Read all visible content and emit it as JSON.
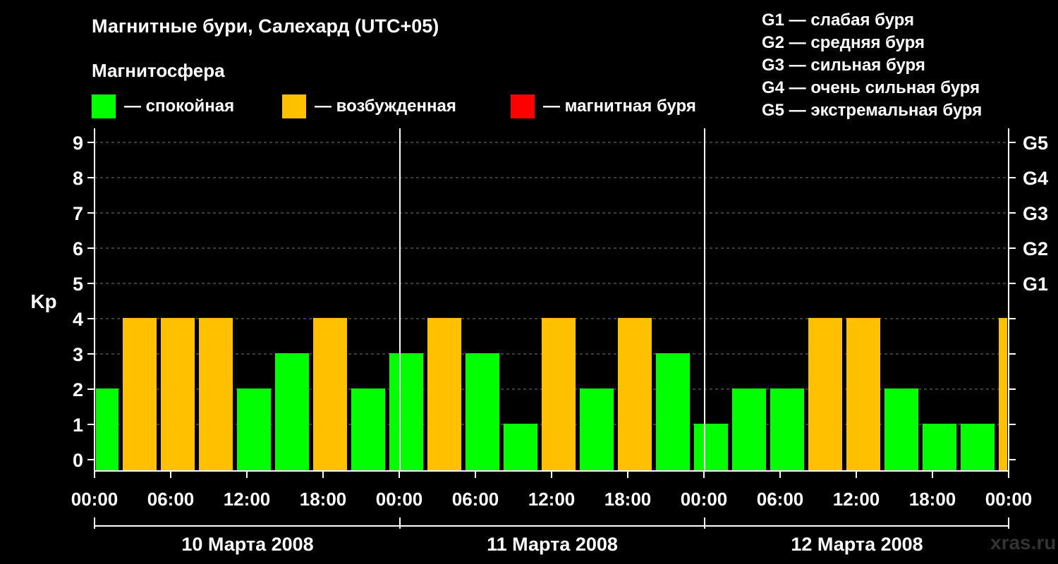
{
  "title": "Магнитные бури, Салехард (UTC+05)",
  "subtitle": "Магнитосфера",
  "legend": [
    {
      "label": "— спокойная",
      "color": "#00ff00"
    },
    {
      "label": "— возбужденная",
      "color": "#ffc000"
    },
    {
      "label": "— магнитная буря",
      "color": "#ff0000"
    }
  ],
  "g_legend": [
    "G1 — слабая буря",
    "G2 — средняя буря",
    "G3 — сильная буря",
    "G4 — очень сильная буря",
    "G5 — экстремальная буря"
  ],
  "watermark": "xras.ru",
  "colors": {
    "quiet": "#00ff00",
    "unsettled": "#ffc000",
    "storm": "#ff0000"
  },
  "chart_data": {
    "type": "bar",
    "ylabel": "Kp",
    "ylim": [
      0,
      9
    ],
    "yticks": [
      0,
      1,
      2,
      3,
      4,
      5,
      6,
      7,
      8,
      9
    ],
    "right_axis_labels": [
      {
        "kp": 5,
        "label": "G1"
      },
      {
        "kp": 6,
        "label": "G2"
      },
      {
        "kp": 7,
        "label": "G3"
      },
      {
        "kp": 8,
        "label": "G4"
      },
      {
        "kp": 9,
        "label": "G5"
      }
    ],
    "x_tick_labels": [
      "00:00",
      "06:00",
      "12:00",
      "18:00",
      "00:00",
      "06:00",
      "12:00",
      "18:00",
      "00:00",
      "06:00",
      "12:00",
      "18:00",
      "00:00"
    ],
    "days": [
      "10 Марта 2008",
      "11 Марта 2008",
      "12 Марта 2008"
    ],
    "grid": true,
    "series": [
      {
        "values": [
          2,
          4,
          4,
          4,
          2,
          3,
          4,
          2,
          3,
          4,
          3,
          1,
          4,
          2,
          4,
          3,
          1,
          2,
          2,
          4,
          4,
          2,
          1,
          1,
          4
        ],
        "levels": [
          "quiet",
          "unsettled",
          "unsettled",
          "unsettled",
          "quiet",
          "quiet",
          "unsettled",
          "quiet",
          "quiet",
          "unsettled",
          "quiet",
          "quiet",
          "unsettled",
          "quiet",
          "unsettled",
          "quiet",
          "quiet",
          "quiet",
          "quiet",
          "unsettled",
          "unsettled",
          "quiet",
          "quiet",
          "quiet",
          "unsettled"
        ]
      }
    ]
  }
}
